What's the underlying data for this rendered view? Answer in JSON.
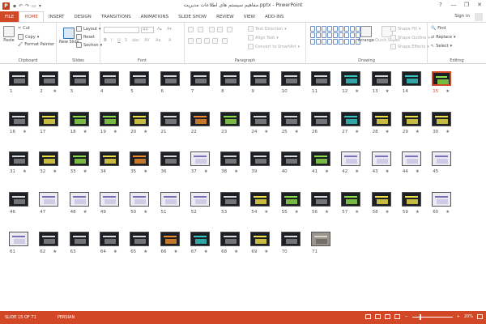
{
  "window": {
    "title": "مفاهیم سیستم های اطلاعات مدیریت.pptx - PowerPoint",
    "controls": [
      "?",
      "—",
      "❐",
      "✕"
    ]
  },
  "tabs": [
    "FILE",
    "HOME",
    "INSERT",
    "DESIGN",
    "TRANSITIONS",
    "ANIMATIONS",
    "SLIDE SHOW",
    "REVIEW",
    "VIEW",
    "ADD-INS"
  ],
  "active_tab": "HOME",
  "signin": "Sign in",
  "ribbon": {
    "clipboard": {
      "label": "Clipboard",
      "paste": "Paste",
      "cut": "Cut",
      "copy": "Copy",
      "format_painter": "Format Painter"
    },
    "slides": {
      "label": "Slides",
      "new_slide": "New Slide",
      "layout": "Layout",
      "reset": "Reset",
      "section": "Section"
    },
    "font": {
      "label": "Font",
      "size": "44"
    },
    "paragraph": {
      "label": "Paragraph",
      "text_direction": "Text Direction",
      "align_text": "Align Text",
      "convert_smartart": "Convert to SmartArt"
    },
    "drawing": {
      "label": "Drawing",
      "arrange": "Arrange",
      "quick_styles": "Quick Styles",
      "shape_fill": "Shape Fill",
      "shape_outline": "Shape Outline",
      "shape_effects": "Shape Effects"
    },
    "editing": {
      "label": "Editing",
      "find": "Find",
      "replace": "Replace",
      "select": "Select"
    }
  },
  "slides": {
    "selected": 15,
    "starred": [
      2,
      12,
      13,
      15,
      16,
      18,
      19,
      20,
      24,
      25,
      27,
      28,
      29,
      30,
      31,
      32,
      33,
      35,
      37,
      38,
      41,
      42,
      43,
      44,
      48,
      50,
      54,
      55,
      56,
      57,
      58,
      59,
      60,
      62,
      64,
      65,
      66,
      67,
      68,
      69
    ],
    "items": [
      {
        "n": 1,
        "theme": "dark"
      },
      {
        "n": 2,
        "theme": "dark"
      },
      {
        "n": 3,
        "theme": "dark"
      },
      {
        "n": 4,
        "theme": "dark"
      },
      {
        "n": 5,
        "theme": "dark"
      },
      {
        "n": 6,
        "theme": "dark"
      },
      {
        "n": 7,
        "theme": "dark"
      },
      {
        "n": 8,
        "theme": "dark"
      },
      {
        "n": 9,
        "theme": "dark"
      },
      {
        "n": 10,
        "theme": "dark"
      },
      {
        "n": 11,
        "theme": "dark"
      },
      {
        "n": 12,
        "theme": "teal"
      },
      {
        "n": 13,
        "theme": "dark"
      },
      {
        "n": 14,
        "theme": "teal"
      },
      {
        "n": 15,
        "theme": "green"
      },
      {
        "n": 16,
        "theme": "dark"
      },
      {
        "n": 17,
        "theme": "yellow"
      },
      {
        "n": 18,
        "theme": "green"
      },
      {
        "n": 19,
        "theme": "green"
      },
      {
        "n": 20,
        "theme": "yellow"
      },
      {
        "n": 21,
        "theme": "dark"
      },
      {
        "n": 22,
        "theme": "orange"
      },
      {
        "n": 23,
        "theme": "green"
      },
      {
        "n": 24,
        "theme": "dark"
      },
      {
        "n": 25,
        "theme": "dark"
      },
      {
        "n": 26,
        "theme": "dark"
      },
      {
        "n": 27,
        "theme": "teal"
      },
      {
        "n": 28,
        "theme": "yellow"
      },
      {
        "n": 29,
        "theme": "yellow"
      },
      {
        "n": 30,
        "theme": "yellow"
      },
      {
        "n": 31,
        "theme": "dark"
      },
      {
        "n": 32,
        "theme": "yellow"
      },
      {
        "n": 33,
        "theme": "green"
      },
      {
        "n": 34,
        "theme": "yellow"
      },
      {
        "n": 35,
        "theme": "orange"
      },
      {
        "n": 36,
        "theme": "dark"
      },
      {
        "n": 37,
        "theme": "light"
      },
      {
        "n": 38,
        "theme": "dark"
      },
      {
        "n": 39,
        "theme": "dark"
      },
      {
        "n": 40,
        "theme": "dark"
      },
      {
        "n": 41,
        "theme": "green"
      },
      {
        "n": 42,
        "theme": "light"
      },
      {
        "n": 43,
        "theme": "light"
      },
      {
        "n": 44,
        "theme": "light"
      },
      {
        "n": 45,
        "theme": "light"
      },
      {
        "n": 46,
        "theme": "dark"
      },
      {
        "n": 47,
        "theme": "light"
      },
      {
        "n": 48,
        "theme": "light"
      },
      {
        "n": 49,
        "theme": "light"
      },
      {
        "n": 50,
        "theme": "light"
      },
      {
        "n": 51,
        "theme": "light"
      },
      {
        "n": 52,
        "theme": "light"
      },
      {
        "n": 53,
        "theme": "dark"
      },
      {
        "n": 54,
        "theme": "yellow"
      },
      {
        "n": 55,
        "theme": "green"
      },
      {
        "n": 56,
        "theme": "dark"
      },
      {
        "n": 57,
        "theme": "green"
      },
      {
        "n": 58,
        "theme": "yellow"
      },
      {
        "n": 59,
        "theme": "yellow"
      },
      {
        "n": 60,
        "theme": "light"
      },
      {
        "n": 61,
        "theme": "light"
      },
      {
        "n": 62,
        "theme": "dark"
      },
      {
        "n": 63,
        "theme": "dark"
      },
      {
        "n": 64,
        "theme": "dark"
      },
      {
        "n": 65,
        "theme": "dark"
      },
      {
        "n": 66,
        "theme": "orange"
      },
      {
        "n": 67,
        "theme": "teal"
      },
      {
        "n": 68,
        "theme": "dark"
      },
      {
        "n": 69,
        "theme": "yellow"
      },
      {
        "n": 70,
        "theme": "dark"
      },
      {
        "n": 71,
        "theme": "photo"
      }
    ]
  },
  "status": {
    "slide_info": "SLIDE 15 OF 71",
    "language": "PERSIAN",
    "zoom": "20%",
    "zoom_fraction": 0.2
  },
  "colors": {
    "accent": "#d24726",
    "file_tab": "#d24726"
  }
}
